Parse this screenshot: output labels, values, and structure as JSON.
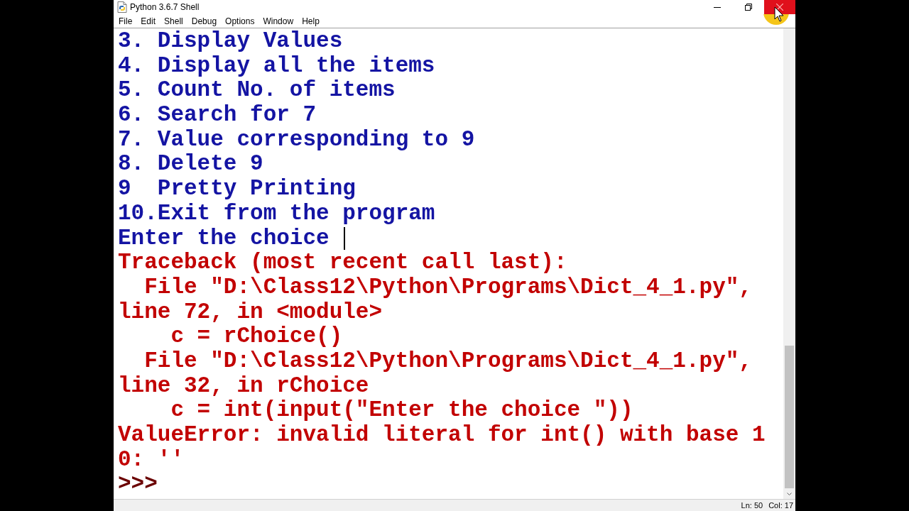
{
  "window": {
    "title": "Python 3.6.7 Shell"
  },
  "menu": [
    "File",
    "Edit",
    "Shell",
    "Debug",
    "Options",
    "Window",
    "Help"
  ],
  "shell": {
    "lines": [
      {
        "text": "3. Display Values",
        "kind": "output",
        "cursor": false
      },
      {
        "text": "4. Display all the items",
        "kind": "output",
        "cursor": false
      },
      {
        "text": "5. Count No. of items",
        "kind": "output",
        "cursor": false
      },
      {
        "text": "6. Search for 7",
        "kind": "output",
        "cursor": false
      },
      {
        "text": "7. Value corresponding to 9",
        "kind": "output",
        "cursor": false
      },
      {
        "text": "8. Delete 9",
        "kind": "output",
        "cursor": false
      },
      {
        "text": "9  Pretty Printing",
        "kind": "output",
        "cursor": false
      },
      {
        "text": "10.Exit from the program",
        "kind": "output",
        "cursor": false
      },
      {
        "text": "Enter the choice ",
        "kind": "output",
        "cursor": true
      },
      {
        "text": "Traceback (most recent call last):",
        "kind": "error",
        "cursor": false
      },
      {
        "text": "  File \"D:\\Class12\\Python\\Programs\\Dict_4_1.py\",",
        "kind": "error",
        "cursor": false
      },
      {
        "text": "line 72, in <module>",
        "kind": "error",
        "cursor": false
      },
      {
        "text": "    c = rChoice()",
        "kind": "error",
        "cursor": false
      },
      {
        "text": "  File \"D:\\Class12\\Python\\Programs\\Dict_4_1.py\",",
        "kind": "error",
        "cursor": false
      },
      {
        "text": "line 32, in rChoice",
        "kind": "error",
        "cursor": false
      },
      {
        "text": "    c = int(input(\"Enter the choice \"))",
        "kind": "error",
        "cursor": false
      },
      {
        "text": "ValueError: invalid literal for int() with base 1",
        "kind": "error",
        "cursor": false
      },
      {
        "text": "0: ''",
        "kind": "error",
        "cursor": false
      },
      {
        "text": ">>>",
        "kind": "prompt",
        "cursor": false
      }
    ]
  },
  "status_bar": {
    "line": "Ln: 50",
    "column": "Col: 17"
  }
}
